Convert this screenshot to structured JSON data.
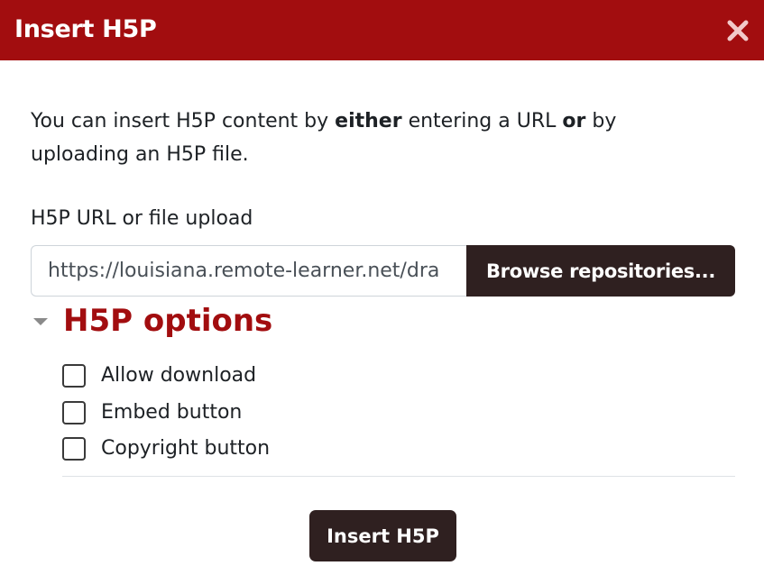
{
  "dialog": {
    "title": "Insert H5P",
    "close_icon": "close-icon"
  },
  "intro": {
    "part1": "You can insert H5P content by ",
    "bold1": "either",
    "part2": " entering a URL ",
    "bold2": "or",
    "part3": " by uploading an H5P file."
  },
  "field": {
    "label": "H5P URL or file upload",
    "value": "https://louisiana.remote-learner.net/dra",
    "browse_label": "Browse repositories..."
  },
  "options": {
    "title": "H5P options",
    "expanded_icon": "caret-down-icon",
    "items": [
      {
        "label": "Allow download",
        "checked": false
      },
      {
        "label": "Embed button",
        "checked": false
      },
      {
        "label": "Copyright button",
        "checked": false
      }
    ]
  },
  "footer": {
    "insert_label": "Insert H5P"
  },
  "colors": {
    "header_bg": "#a20d0f",
    "accent": "#a20d0f",
    "button_bg": "#2f2020"
  }
}
